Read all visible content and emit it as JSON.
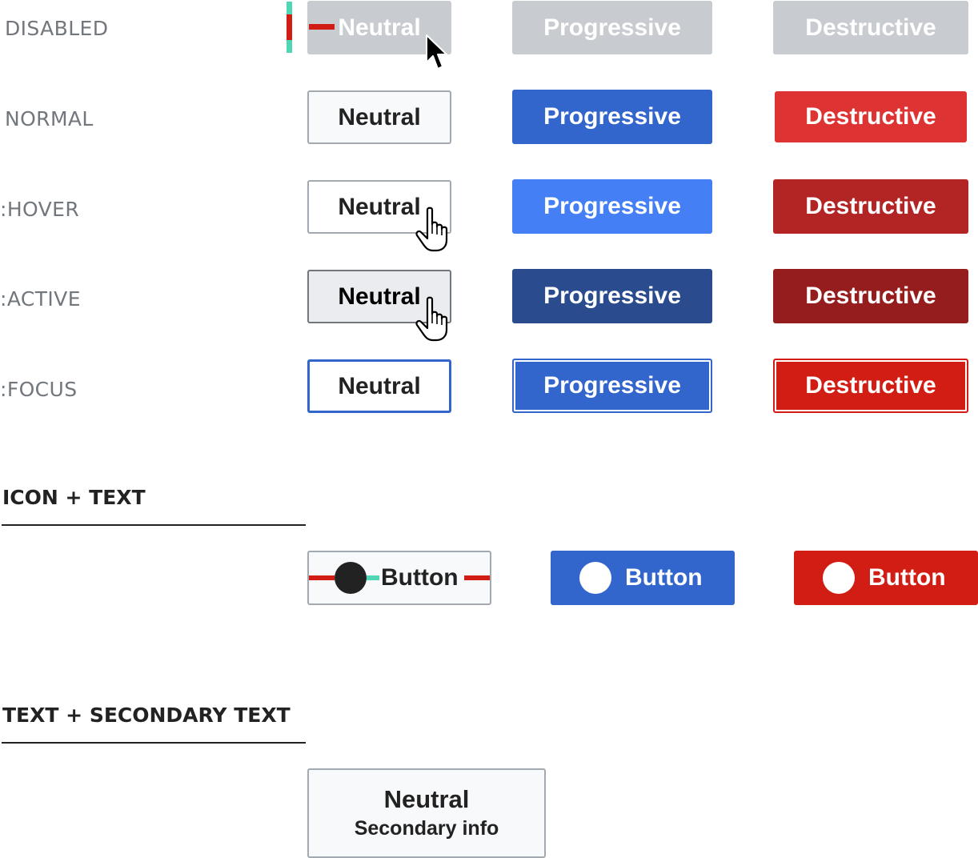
{
  "states": {
    "disabled": "DISABLED",
    "normal": "NORMAL",
    "hover": ":HOVER",
    "active": ":ACTIVE",
    "focus": ":FOCUS"
  },
  "buttons": {
    "neutral": "Neutral",
    "progressive": "Progressive",
    "destructive": "Destructive"
  },
  "sections": {
    "icon_text": "ICON + TEXT",
    "text_secondary": "TEXT + SECONDARY TEXT"
  },
  "icon_buttons": {
    "label": "Button"
  },
  "secondary_button": {
    "main": "Neutral",
    "secondary": "Secondary info"
  },
  "colors": {
    "neutral_normal_bg": "#f8f9fa",
    "border_gray": "#a2a9b1",
    "disabled_bg": "#c8ccd1",
    "progressive": "#3366cc",
    "progressive_hover": "#447ff5",
    "progressive_active": "#2a4b8d",
    "destructive": "#dd3333",
    "destructive_hover": "#b32424",
    "destructive_active": "#961d1d",
    "destructive_focus": "#d11d13",
    "annotation_red": "#d11d13",
    "annotation_teal": "#4fd6b5"
  },
  "cursors": {
    "disabled": "arrow-cursor-icon",
    "hover": "hand-pointer-icon",
    "active": "hand-pointer-icon"
  }
}
